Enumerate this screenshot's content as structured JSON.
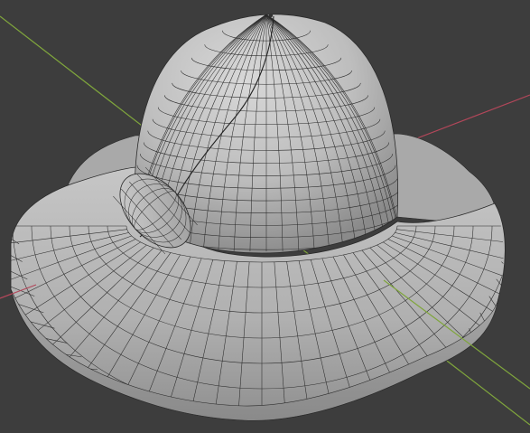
{
  "viewport": {
    "background": "#3d3d3d",
    "axes": {
      "x_color": "#b3475a",
      "y_color": "#7fa53c"
    },
    "object": {
      "name": "hat",
      "shading": "solid",
      "overlay": "wireframe",
      "surface_color": "#b9b9b9",
      "edge_color": "#2a2a2a"
    }
  }
}
